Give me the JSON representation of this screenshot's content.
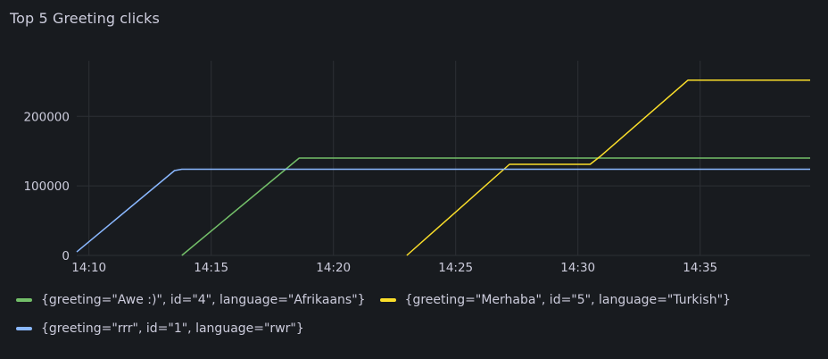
{
  "panel": {
    "title": "Top 5 Greeting clicks"
  },
  "chart_data": {
    "type": "line",
    "title": "Top 5 Greeting clicks",
    "xlabel": "",
    "ylabel": "",
    "x_unit": "minutes (time of day)",
    "xlim": [
      "14:09.5",
      "14:39.5"
    ],
    "ylim": [
      0,
      280000
    ],
    "x_ticks": [
      "14:10",
      "14:15",
      "14:20",
      "14:25",
      "14:30",
      "14:35"
    ],
    "y_ticks": [
      "0",
      "100000",
      "200000"
    ],
    "y_tick_values": [
      0,
      100000,
      200000
    ],
    "grid": true,
    "legend_position": "bottom",
    "series": [
      {
        "name": "{greeting=\"Awe :)\", id=\"4\", language=\"Afrikaans\"}",
        "color": "#73bf69",
        "points": [
          [
            "14:13.8",
            0
          ],
          [
            "14:18.6",
            140000
          ],
          [
            "14:39.5",
            140000
          ]
        ]
      },
      {
        "name": "{greeting=\"Merhaba\", id=\"5\", language=\"Turkish\"}",
        "color": "#fade2a",
        "points": [
          [
            "14:23.0",
            0
          ],
          [
            "14:27.2",
            131000
          ],
          [
            "14:30.5",
            131000
          ],
          [
            "14:30.9",
            142000
          ],
          [
            "14:34.5",
            252000
          ],
          [
            "14:39.5",
            252000
          ]
        ]
      },
      {
        "name": "{greeting=\"rrr\", id=\"1\", language=\"rwr\"}",
        "color": "#8ab8ff",
        "points": [
          [
            "14:09.5",
            5000
          ],
          [
            "14:13.5",
            122000
          ],
          [
            "14:13.8",
            124000
          ],
          [
            "14:39.5",
            124000
          ]
        ]
      }
    ]
  }
}
